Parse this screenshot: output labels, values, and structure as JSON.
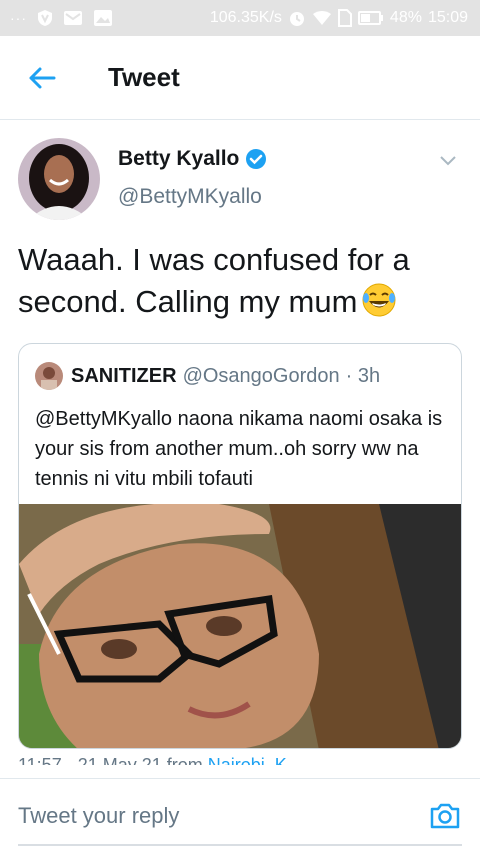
{
  "status_bar": {
    "dots": "···",
    "speed": "106.35K/s",
    "battery": "48%",
    "time": "15:09"
  },
  "header": {
    "title": "Tweet",
    "back_icon": "arrow-left-icon"
  },
  "tweet": {
    "author_name": "Betty Kyallo",
    "author_handle": "@BettyMKyallo",
    "text": "Waaah. I was confused for a second. Calling my mum",
    "emoji": "laughing-tears-emoji"
  },
  "quote": {
    "name": "SANITIZER",
    "handle": "@OsangoGordon",
    "time": "· 3h",
    "text": "@BettyMKyallo naona nikama naomi osaka is your sis from another mum..oh sorry ww na tennis ni vitu mbili tofauti"
  },
  "timestamp": {
    "time": "11:57 · 21 May 21 from",
    "place": "Nairobi, K"
  },
  "reply": {
    "placeholder": "Tweet your reply",
    "camera_icon": "camera-icon"
  },
  "colors": {
    "accent": "#1da1f2",
    "secondary_text": "#657786",
    "divider": "#e1e8ed"
  }
}
